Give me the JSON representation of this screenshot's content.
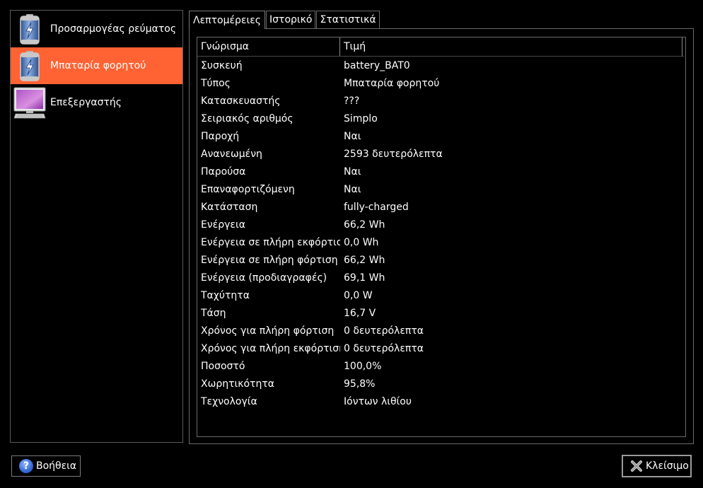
{
  "colors": {
    "selection": "#ff6233",
    "background": "#000000",
    "text": "#ffffff",
    "border": "#6a6a6a"
  },
  "devices": [
    {
      "label": "Προσαρμογέας ρεύματος",
      "icon": "battery-icon"
    },
    {
      "label": "Μπαταρία φορητού",
      "icon": "battery-icon",
      "selected": true
    },
    {
      "label": "Επεξεργαστής",
      "icon": "computer-icon"
    }
  ],
  "tabs": [
    {
      "label": "Λεπτομέρειες",
      "active": true
    },
    {
      "label": "Ιστορικό"
    },
    {
      "label": "Στατιστικά"
    }
  ],
  "table": {
    "headers": {
      "property": "Γνώρισμα",
      "value": "Τιμή"
    },
    "rows": [
      {
        "property": "Συσκευή",
        "value": "battery_BAT0"
      },
      {
        "property": "Τύπος",
        "value": "Μπαταρία φορητού"
      },
      {
        "property": "Κατασκευαστής",
        "value": "???"
      },
      {
        "property": "Σειριακός αριθμός",
        "value": "Simplo"
      },
      {
        "property": "Παροχή",
        "value": "Ναι"
      },
      {
        "property": "Ανανεωμένη",
        "value": "2593 δευτερόλεπτα"
      },
      {
        "property": "Παρούσα",
        "value": "Ναι"
      },
      {
        "property": "Επαναφορτιζόμενη",
        "value": "Ναι"
      },
      {
        "property": "Κατάσταση",
        "value": "fully-charged"
      },
      {
        "property": "Ενέργεια",
        "value": "66,2 Wh"
      },
      {
        "property": "Ενέργεια σε πλήρη εκφόρτιση",
        "value": "0,0 Wh"
      },
      {
        "property": "Ενέργεια σε πλήρη φόρτιση",
        "value": "66,2 Wh"
      },
      {
        "property": "Ενέργεια (προδιαγραφές)",
        "value": "69,1 Wh"
      },
      {
        "property": "Ταχύτητα",
        "value": "0,0 W"
      },
      {
        "property": "Τάση",
        "value": "16,7 V"
      },
      {
        "property": "Χρόνος για πλήρη φόρτιση",
        "value": "0 δευτερόλεπτα"
      },
      {
        "property": "Χρόνος για πλήρη εκφόρτιση",
        "value": "0 δευτερόλεπτα"
      },
      {
        "property": "Ποσοστό",
        "value": "100,0%"
      },
      {
        "property": "Χωρητικότητα",
        "value": "95,8%"
      },
      {
        "property": "Τεχνολογία",
        "value": "Ιόντων λιθίου"
      }
    ]
  },
  "buttons": {
    "help": {
      "label": "Βοήθεια",
      "icon": "help-icon"
    },
    "close": {
      "label": "Κλείσιμο",
      "icon": "close-icon"
    }
  }
}
